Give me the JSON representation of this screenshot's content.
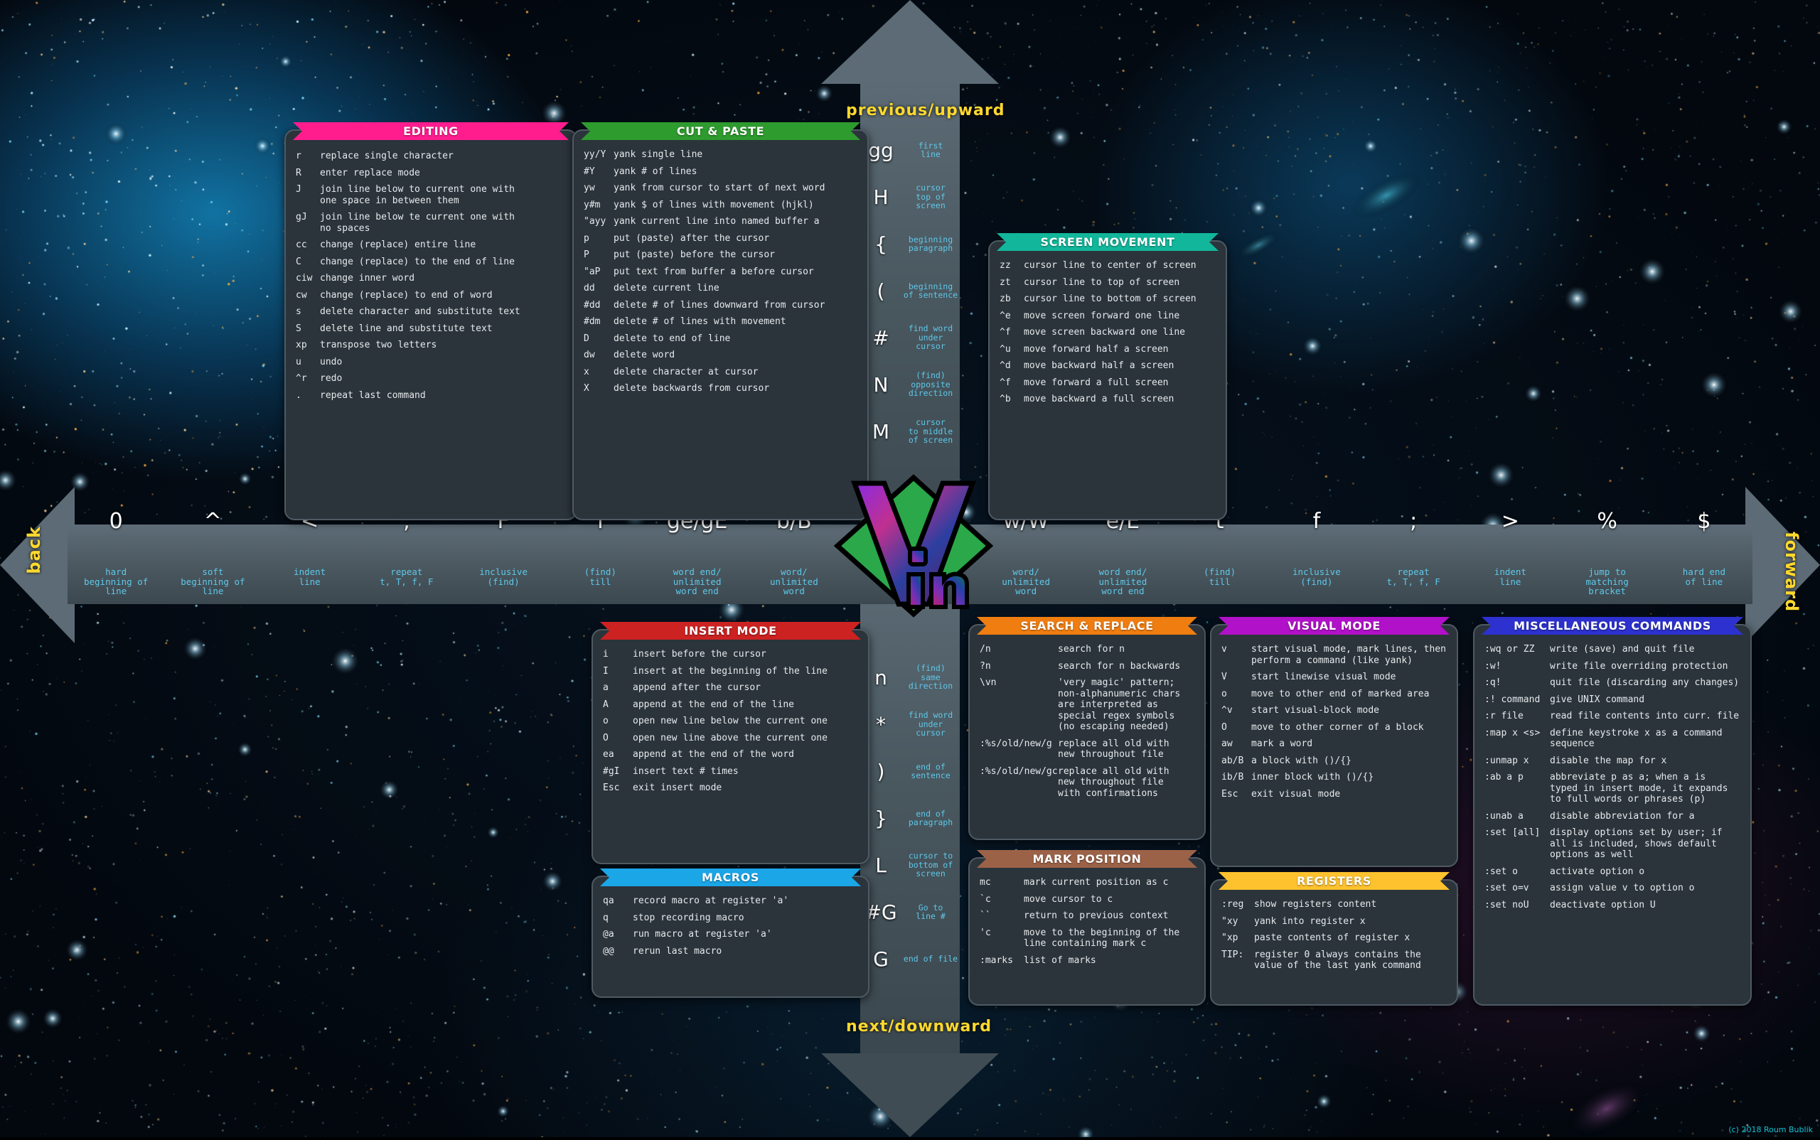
{
  "arrows": {
    "previous": "previous/upward",
    "next": "next/downward",
    "back": "back",
    "forward": "forward"
  },
  "copyright": "(c) 2018 Roum Bublik",
  "colors": {
    "editing": "#ff1d8e",
    "cut_paste": "#2e9b2e",
    "screen_movement": "#12b79b",
    "insert_mode": "#cc2222",
    "macros": "#1ba6e8",
    "search_replace": "#f07d10",
    "mark_position": "#9c6248",
    "visual_mode": "#b111c9",
    "registers": "#fdc22e",
    "miscellaneous": "#2c31cf",
    "arrow_label": "#ffd92e",
    "motion_desc": "#5ec8e8",
    "panel_bg": "#2b343b",
    "panel_border": "#4e5a63"
  },
  "horizontal_motion": {
    "left": [
      {
        "key": "0",
        "desc": "hard\nbeginning of\nline"
      },
      {
        "key": "^",
        "desc": "soft\nbeginning of\nline"
      },
      {
        "key": "<",
        "desc": "indent\nline"
      },
      {
        "key": ",",
        "desc": "repeat\nt, T, f, F"
      },
      {
        "key": "F",
        "desc": "inclusive\n(find)"
      },
      {
        "key": "T",
        "desc": "(find)\ntill"
      },
      {
        "key": "ge/gE",
        "desc": "word end/\nunlimited\nword end"
      },
      {
        "key": "b/B",
        "desc": "word/\nunlimited\nword"
      }
    ],
    "right": [
      {
        "key": "w/W",
        "desc": "word/\nunlimited\nword"
      },
      {
        "key": "e/E",
        "desc": "word end/\nunlimited\nword end"
      },
      {
        "key": "t",
        "desc": "(find)\ntill"
      },
      {
        "key": "f",
        "desc": "inclusive\n(find)"
      },
      {
        "key": ";",
        "desc": "repeat\nt, T, f, F"
      },
      {
        "key": ">",
        "desc": "indent\nline"
      },
      {
        "key": "%",
        "desc": "jump to\nmatching\nbracket"
      },
      {
        "key": "$",
        "desc": "hard end\nof line"
      }
    ]
  },
  "vertical_motion": {
    "up": [
      {
        "key": "gg",
        "desc": "first\nline"
      },
      {
        "key": "H",
        "desc": "cursor\ntop of\nscreen"
      },
      {
        "key": "{",
        "desc": "beginning\nparagraph"
      },
      {
        "key": "(",
        "desc": "beginning\nof sentence"
      },
      {
        "key": "#",
        "desc": "find word\nunder\ncursor"
      },
      {
        "key": "N",
        "desc": "(find)\nopposite\ndirection"
      },
      {
        "key": "M",
        "desc": "cursor\nto middle\nof screen"
      }
    ],
    "down": [
      {
        "key": "n",
        "desc": "(find)\nsame\ndirection"
      },
      {
        "key": "*",
        "desc": "find word\nunder\ncursor"
      },
      {
        "key": ")",
        "desc": "end of\nsentence"
      },
      {
        "key": "}",
        "desc": "end of\nparagraph"
      },
      {
        "key": "L",
        "desc": "cursor to\nbottom of\nscreen"
      },
      {
        "key": "#G",
        "desc": "Go to\nline #"
      },
      {
        "key": "G",
        "desc": "end of file"
      }
    ]
  },
  "panels": {
    "editing": {
      "title": "EDITING",
      "rows": [
        {
          "key": "r",
          "desc": "replace single character"
        },
        {
          "key": "R",
          "desc": "enter replace mode"
        },
        {
          "key": "J",
          "desc": "join line below to current one with\none space in between them"
        },
        {
          "key": "gJ",
          "desc": "join line below te current one with\nno spaces"
        },
        {
          "key": "cc",
          "desc": "change (replace) entire line"
        },
        {
          "key": "C",
          "desc": "change (replace) to the end of line"
        },
        {
          "key": "ciw",
          "desc": "change inner word"
        },
        {
          "key": "cw",
          "desc": "change (replace) to end of word"
        },
        {
          "key": "s",
          "desc": "delete character and substitute text"
        },
        {
          "key": "S",
          "desc": "delete line and substitute text"
        },
        {
          "key": "xp",
          "desc": "transpose two letters"
        },
        {
          "key": "u",
          "desc": "undo"
        },
        {
          "key": "^r",
          "desc": "redo"
        },
        {
          "key": ".",
          "desc": "repeat last command"
        }
      ]
    },
    "cut_paste": {
      "title": "CUT & PASTE",
      "rows": [
        {
          "key": "yy/Y",
          "desc": "yank single line"
        },
        {
          "key": "#Y",
          "desc": "yank # of lines"
        },
        {
          "key": "yw",
          "desc": "yank from cursor to start of next word"
        },
        {
          "key": "y#m",
          "desc": "yank $ of lines with movement (hjkl)"
        },
        {
          "key": "\"ayy",
          "desc": "yank current line into named buffer a"
        },
        {
          "key": "p",
          "desc": "put (paste) after the cursor"
        },
        {
          "key": "P",
          "desc": "put (paste) before the cursor"
        },
        {
          "key": "\"aP",
          "desc": "put text from buffer a before cursor"
        },
        {
          "key": "dd",
          "desc": "delete current line"
        },
        {
          "key": "#dd",
          "desc": "delete # of lines downward from cursor"
        },
        {
          "key": "#dm",
          "desc": "delete # of lines with movement"
        },
        {
          "key": "D",
          "desc": "delete to end of line"
        },
        {
          "key": "dw",
          "desc": "delete word"
        },
        {
          "key": "x",
          "desc": "delete character at cursor"
        },
        {
          "key": "X",
          "desc": "delete backwards from cursor"
        }
      ]
    },
    "screen_movement": {
      "title": "SCREEN MOVEMENT",
      "rows": [
        {
          "key": "zz",
          "desc": "cursor line to center of screen"
        },
        {
          "key": "zt",
          "desc": "cursor line to top of screen"
        },
        {
          "key": "zb",
          "desc": "cursor line to bottom of screen"
        },
        {
          "key": "^e",
          "desc": "move screen forward one line"
        },
        {
          "key": "^f",
          "desc": "move screen backward one line"
        },
        {
          "key": "^u",
          "desc": "move forward half a screen"
        },
        {
          "key": "^d",
          "desc": "move backward half a screen"
        },
        {
          "key": "^f",
          "desc": "move forward a full screen"
        },
        {
          "key": "^b",
          "desc": "move backward a full screen"
        }
      ]
    },
    "insert_mode": {
      "title": "INSERT MODE",
      "rows": [
        {
          "key": "i",
          "desc": "insert before the cursor"
        },
        {
          "key": "I",
          "desc": "insert at the beginning of the line"
        },
        {
          "key": "a",
          "desc": "append after the cursor"
        },
        {
          "key": "A",
          "desc": "append at the end of the line"
        },
        {
          "key": "o",
          "desc": "open new line below the current one"
        },
        {
          "key": "O",
          "desc": "open new line above the current one"
        },
        {
          "key": "ea",
          "desc": "append at the end of the word"
        },
        {
          "key": "#gI",
          "desc": "insert text # times"
        },
        {
          "key": "Esc",
          "desc": "exit insert mode"
        }
      ]
    },
    "macros": {
      "title": "MACROS",
      "rows": [
        {
          "key": "qa",
          "desc": "record macro at register 'a'"
        },
        {
          "key": "q",
          "desc": "stop recording macro"
        },
        {
          "key": "@a",
          "desc": "run macro at register 'a'"
        },
        {
          "key": "@@",
          "desc": "rerun last macro"
        }
      ]
    },
    "search_replace": {
      "title": "SEARCH & REPLACE",
      "rows": [
        {
          "key": "/n",
          "desc": "search for n"
        },
        {
          "key": "?n",
          "desc": "search for n backwards"
        },
        {
          "key": "\\vn",
          "desc": "'very magic' pattern;\nnon-alphanumeric chars\nare interpreted as\nspecial regex symbols\n(no escaping needed)"
        },
        {
          "key": ":%s/old/new/g",
          "desc": "replace all old with\nnew throughout file"
        },
        {
          "key": ":%s/old/new/gc",
          "desc": "replace all old with\nnew throughout file\nwith confirmations"
        }
      ]
    },
    "mark_position": {
      "title": "MARK POSITION",
      "rows": [
        {
          "key": "mc",
          "desc": "mark current position as c"
        },
        {
          "key": "`c",
          "desc": "move cursor to c"
        },
        {
          "key": "``",
          "desc": "return to previous context"
        },
        {
          "key": "'c",
          "desc": "move to the beginning of the\nline containing mark c"
        },
        {
          "key": ":marks",
          "desc": "list of marks"
        }
      ]
    },
    "visual_mode": {
      "title": "VISUAL MODE",
      "rows": [
        {
          "key": "v",
          "desc": "start visual mode, mark lines, then\nperform a command (like yank)"
        },
        {
          "key": "V",
          "desc": "start linewise visual mode"
        },
        {
          "key": "o",
          "desc": "move to other end of marked area"
        },
        {
          "key": "^v",
          "desc": "start visual-block mode"
        },
        {
          "key": "O",
          "desc": "move to other corner of a block"
        },
        {
          "key": "aw",
          "desc": "mark a word"
        },
        {
          "key": "ab/B",
          "desc": "a block with ()/{}"
        },
        {
          "key": "ib/B",
          "desc": "inner block with ()/{}"
        },
        {
          "key": "Esc",
          "desc": "exit visual mode"
        }
      ]
    },
    "registers": {
      "title": "REGISTERS",
      "rows": [
        {
          "key": ":reg",
          "desc": "show registers content"
        },
        {
          "key": "\"xy",
          "desc": "yank into register x"
        },
        {
          "key": "\"xp",
          "desc": "paste contents of register x"
        },
        {
          "key": "TIP:",
          "desc": "register 0 always contains the\nvalue of the last yank command"
        }
      ]
    },
    "miscellaneous": {
      "title": "MISCELLANEOUS COMMANDS",
      "rows": [
        {
          "key": ":wq or ZZ",
          "desc": "write (save) and quit file"
        },
        {
          "key": ":w!",
          "desc": "write file overriding protection"
        },
        {
          "key": ":q!",
          "desc": "quit file (discarding any changes)"
        },
        {
          "key": ":! command",
          "desc": "give UNIX command"
        },
        {
          "key": ":r file",
          "desc": "read file contents into curr. file"
        },
        {
          "key": ":map x <s>",
          "desc": "define keystroke x as a command\nsequence"
        },
        {
          "key": ":unmap x",
          "desc": "disable the map for x"
        },
        {
          "key": ":ab a p",
          "desc": "abbreviate p as a; when a is\ntyped in insert mode, it expands\nto full words or phrases (p)"
        },
        {
          "key": ":unab a",
          "desc": "disable abbreviation for a"
        },
        {
          "key": ":set [all]",
          "desc": "display options set by user; if\nall is included, shows default\noptions as well"
        },
        {
          "key": ":set o",
          "desc": "activate option o"
        },
        {
          "key": ":set o=v",
          "desc": "assign value v to option o"
        },
        {
          "key": ":set noU",
          "desc": "deactivate option U"
        }
      ]
    }
  }
}
